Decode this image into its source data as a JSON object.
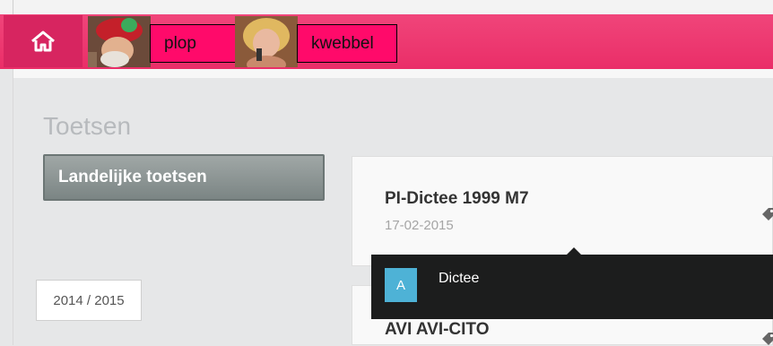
{
  "nav": {
    "home_icon": "home-icon",
    "users": [
      {
        "name": "plop",
        "avatar": "avatar-plop"
      },
      {
        "name": "kwebbel",
        "avatar": "avatar-kwebbel"
      }
    ]
  },
  "main": {
    "title": "Toetsen",
    "category_button": "Landelijke toetsen",
    "year_button": "2014 / 2015"
  },
  "tests": [
    {
      "title": "PI-Dictee 1999 M7",
      "date": "17-02-2015",
      "icon": "tag-icon"
    },
    {
      "title": "AVI AVI-CITO",
      "icon": "tag-icon"
    }
  ],
  "tooltip": {
    "badge": "A",
    "text": "Dictee"
  },
  "colors": {
    "navbar": "#ea2e68",
    "home": "#d72560",
    "user_label": "#ff0a6a",
    "badge": "#4eb2d6",
    "tooltip_bg": "#1c1d1d"
  }
}
